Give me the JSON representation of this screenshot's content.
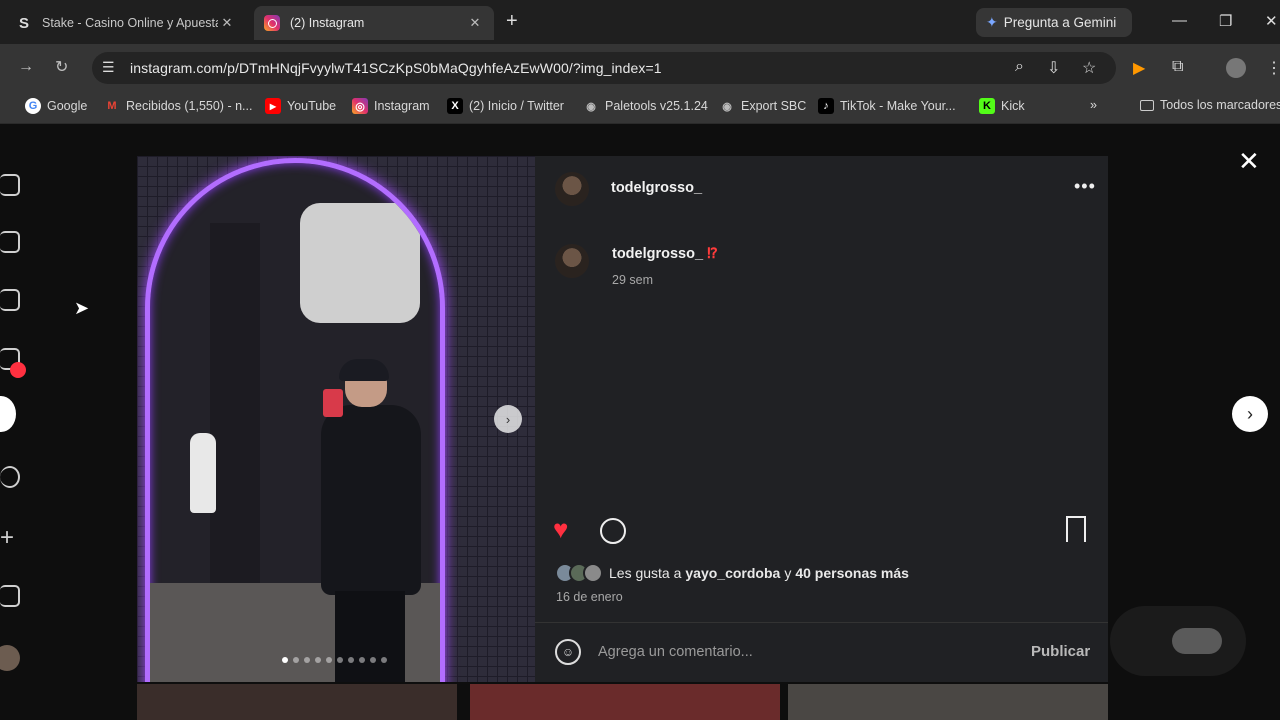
{
  "browser": {
    "tabs": [
      {
        "title": "Stake - Casino Online y Apuestas",
        "favicon": "S",
        "active": false
      },
      {
        "title": "(2) Instagram",
        "favicon": "instagram-icon",
        "active": true
      }
    ],
    "new_tab": "+",
    "gemini_label": "Pregunta a Gemini",
    "url": "instagram.com/p/DTmHNqjFvyylwT41SCzKpS0bMaQgyhfeAzEwW00/?img_index=1",
    "bookmarks": [
      {
        "label": "Google",
        "icon": "G",
        "color": "#4285f4"
      },
      {
        "label": "Recibidos (1,550) - n...",
        "icon": "M",
        "color": "#ea4335"
      },
      {
        "label": "YouTube",
        "icon": "▶",
        "color": "#ff0000"
      },
      {
        "label": "Instagram",
        "icon": "◎",
        "color": "#e1306c"
      },
      {
        "label": "(2) Inicio / Twitter",
        "icon": "X",
        "color": "#000000"
      },
      {
        "label": "Paletools v25.1.24",
        "icon": "◉",
        "color": "#888888"
      },
      {
        "label": "Export SBC",
        "icon": "◉",
        "color": "#888888"
      },
      {
        "label": "TikTok - Make Your...",
        "icon": "♪",
        "color": "#000000"
      },
      {
        "label": "Kick",
        "icon": "K",
        "color": "#53fc18"
      }
    ],
    "bookmarks_more": "»",
    "all_bookmarks": "Todos los marcadores"
  },
  "post": {
    "username": "todelgrosso_",
    "caption_emoji": "⁉",
    "age": "29 sem",
    "likes_prefix": "Les gusta a",
    "likes_user": "yayo_cordoba",
    "likes_and": "y",
    "likes_others": "40 personas más",
    "date": "16 de enero",
    "comment_placeholder": "Agrega un comentario...",
    "publish_label": "Publicar",
    "image_count": 10,
    "current_image": 1
  },
  "colors": {
    "like": "#ff3040",
    "neon": "#b26dff"
  }
}
